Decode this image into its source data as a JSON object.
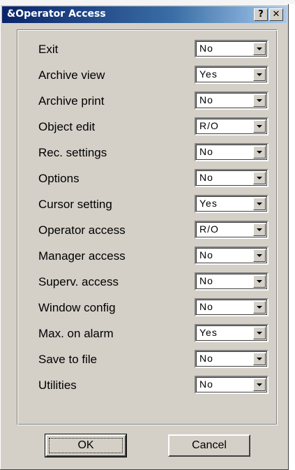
{
  "window": {
    "title": "&Operator Access",
    "help_label": "?",
    "close_label": "✕"
  },
  "rows": [
    {
      "label": "Exit",
      "value": "No"
    },
    {
      "label": "Archive view",
      "value": "Yes"
    },
    {
      "label": "Archive print",
      "value": "No"
    },
    {
      "label": "Object edit",
      "value": "R/O"
    },
    {
      "label": "Rec. settings",
      "value": "No"
    },
    {
      "label": "Options",
      "value": "No"
    },
    {
      "label": "Cursor setting",
      "value": "Yes"
    },
    {
      "label": "Operator access",
      "value": "R/O"
    },
    {
      "label": "Manager access",
      "value": "No"
    },
    {
      "label": "Superv. access",
      "value": "No"
    },
    {
      "label": "Window config",
      "value": "No"
    },
    {
      "label": "Max. on alarm",
      "value": "Yes"
    },
    {
      "label": "Save to file",
      "value": "No"
    },
    {
      "label": "Utilities",
      "value": "No"
    }
  ],
  "buttons": {
    "ok_label": "OK",
    "cancel_label": "Cancel"
  },
  "icons": {
    "help": "help-icon",
    "close": "close-icon",
    "dropdown": "chevron-down-icon"
  }
}
